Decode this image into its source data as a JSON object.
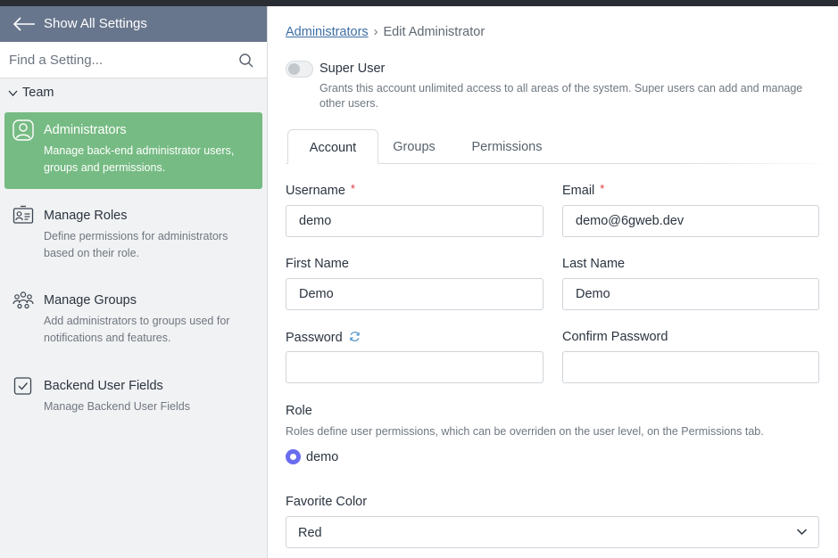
{
  "sidebar": {
    "back_label": "Show All Settings",
    "search_placeholder": "Find a Setting...",
    "section_label": "Team",
    "items": [
      {
        "title": "Administrators",
        "desc": "Manage back-end administrator users, groups and permissions.",
        "icon": "user-circle-icon",
        "active": true
      },
      {
        "title": "Manage Roles",
        "desc": "Define permissions for administrators based on their role.",
        "icon": "id-card-icon",
        "active": false
      },
      {
        "title": "Manage Groups",
        "desc": "Add administrators to groups used for notifications and features.",
        "icon": "users-group-icon",
        "active": false
      },
      {
        "title": "Backend User Fields",
        "desc": "Manage Backend User Fields",
        "icon": "checkbox-icon",
        "active": false
      }
    ]
  },
  "breadcrumb": {
    "parent": "Administrators",
    "separator": "›",
    "current": "Edit Administrator"
  },
  "super_user": {
    "label": "Super User",
    "help": "Grants this account unlimited access to all areas of the system. Super users can add and manage other users.",
    "enabled": false
  },
  "tabs": [
    {
      "label": "Account",
      "active": true
    },
    {
      "label": "Groups",
      "active": false
    },
    {
      "label": "Permissions",
      "active": false
    }
  ],
  "form": {
    "username": {
      "label": "Username",
      "required": "*",
      "value": "demo"
    },
    "email": {
      "label": "Email",
      "required": "*",
      "value": "demo@6gweb.dev"
    },
    "first_name": {
      "label": "First Name",
      "value": "Demo"
    },
    "last_name": {
      "label": "Last Name",
      "value": "Demo"
    },
    "password": {
      "label": "Password",
      "value": ""
    },
    "confirm_password": {
      "label": "Confirm Password",
      "value": ""
    },
    "role": {
      "label": "Role",
      "help": "Roles define user permissions, which can be overriden on the user level, on the Permissions tab.",
      "selected": "demo"
    },
    "favorite_color": {
      "label": "Favorite Color",
      "value": "Red"
    }
  },
  "colors": {
    "back_bar": "#68768d",
    "active_item": "#76bb83",
    "link": "#3d6ea5",
    "required": "#e0383e",
    "radio": "#6a6cf0"
  }
}
